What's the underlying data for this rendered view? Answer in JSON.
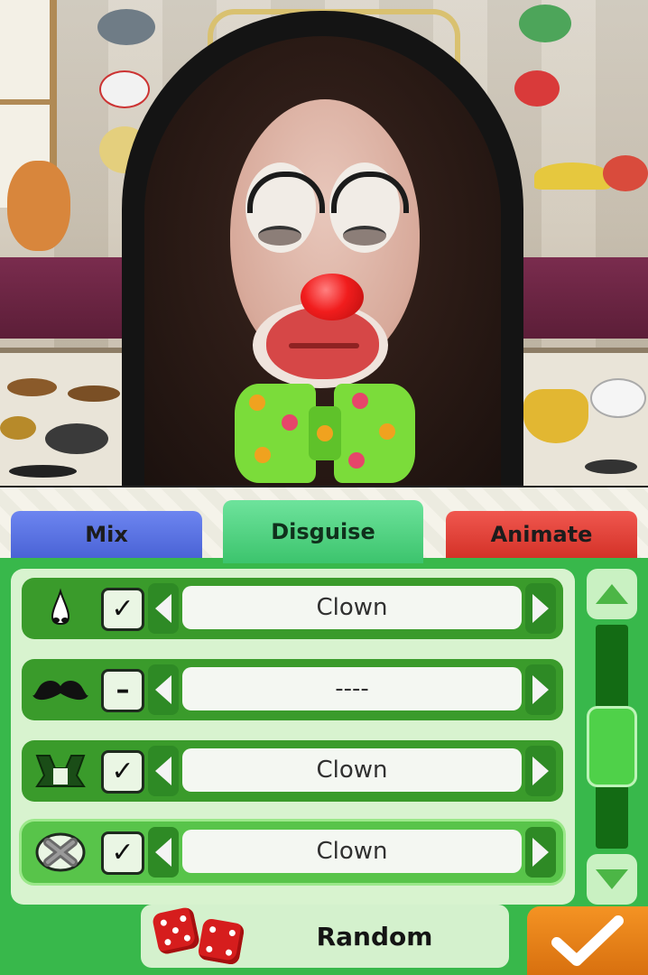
{
  "tabs": {
    "mix": "Mix",
    "disguise": "Disguise",
    "animate": "Animate",
    "active": "Disguise"
  },
  "disguise_rows": [
    {
      "icon": "nose-icon",
      "checked": true,
      "mark": "✓",
      "value": "Clown",
      "selected": false
    },
    {
      "icon": "mustache-icon",
      "checked": false,
      "mark": "–",
      "value": "----",
      "selected": false
    },
    {
      "icon": "neckwear-icon",
      "checked": true,
      "mark": "✓",
      "value": "Clown",
      "selected": false
    },
    {
      "icon": "face-paint-icon",
      "checked": true,
      "mark": "✓",
      "value": "Clown",
      "selected": true
    }
  ],
  "random_button": "Random",
  "confirm_icon": "checkmark-icon",
  "colors": {
    "tab_mix": "#4a63d6",
    "tab_disguise": "#3cc46d",
    "tab_animate": "#d43228",
    "panel": "#38b84b",
    "confirm": "#f49323",
    "clown_nose": "#f11d1d",
    "bowtie": "#7bdc3a"
  }
}
